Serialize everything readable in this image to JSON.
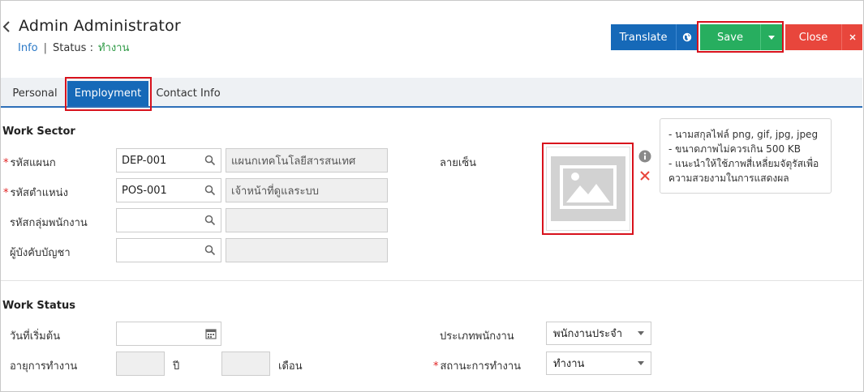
{
  "header": {
    "back_icon": "chevron-left-icon",
    "title": "Admin Administrator",
    "info_link": "Info",
    "separator": "|",
    "status_label": "Status",
    "status_colon": ":",
    "status_value": "ทำงาน",
    "status_value_color": "#2e9a45"
  },
  "toolbar": {
    "translate_label": "Translate",
    "translate_icon": "globe-icon",
    "save_label": "Save",
    "save_dropdown_icon": "caret-down-icon",
    "close_label": "Close",
    "close_icon": "close-icon",
    "colors": {
      "translate": "#1669b8",
      "save": "#27ae5f",
      "close": "#e8463c",
      "highlight": "#d8121c"
    }
  },
  "tabs": [
    {
      "label": "Personal",
      "active": false
    },
    {
      "label": "Employment",
      "active": true
    },
    {
      "label": "Contact Info",
      "active": false
    }
  ],
  "work_sector": {
    "title": "Work Sector",
    "fields": [
      {
        "label": "รหัสแผนก",
        "required": true,
        "value": "DEP-001",
        "description": "แผนกเทคโนโลยีสารสนเทศ"
      },
      {
        "label": "รหัสตำแหน่ง",
        "required": true,
        "value": "POS-001",
        "description": "เจ้าหน้าที่ดูแลระบบ"
      },
      {
        "label": "รหัสกลุ่มพนักงาน",
        "required": false,
        "value": "",
        "description": ""
      },
      {
        "label": "ผู้บังคับบัญชา",
        "required": false,
        "value": "",
        "description": ""
      }
    ],
    "signature_label": "ลายเซ็น",
    "signature_icon": "image-placeholder-icon",
    "info_icon": "info-icon",
    "remove_icon": "remove-x-icon",
    "tooltip_lines": [
      "- นามสกุลไฟล์ png, gif, jpg, jpeg",
      "- ขนาดภาพไม่ควรเกิน 500 KB",
      "- แนะนำให้ใช้ภาพสี่เหลี่ยมจัตุรัสเพื่อ",
      "ความสวยงามในการแสดงผล"
    ]
  },
  "work_status": {
    "title": "Work Status",
    "start_date_label": "วันที่เริ่มต้น",
    "start_date_value": "",
    "calendar_icon": "calendar-icon",
    "tenure_label": "อายุการทำงาน",
    "years_value": "",
    "years_unit": "ปี",
    "months_value": "",
    "months_unit": "เดือน",
    "employee_type_label": "ประเภทพนักงาน",
    "employee_type_value": "พนักงานประจำ",
    "work_status_label": "สถานะการทำงาน",
    "work_status_required": true,
    "work_status_value": "ทำงาน"
  }
}
